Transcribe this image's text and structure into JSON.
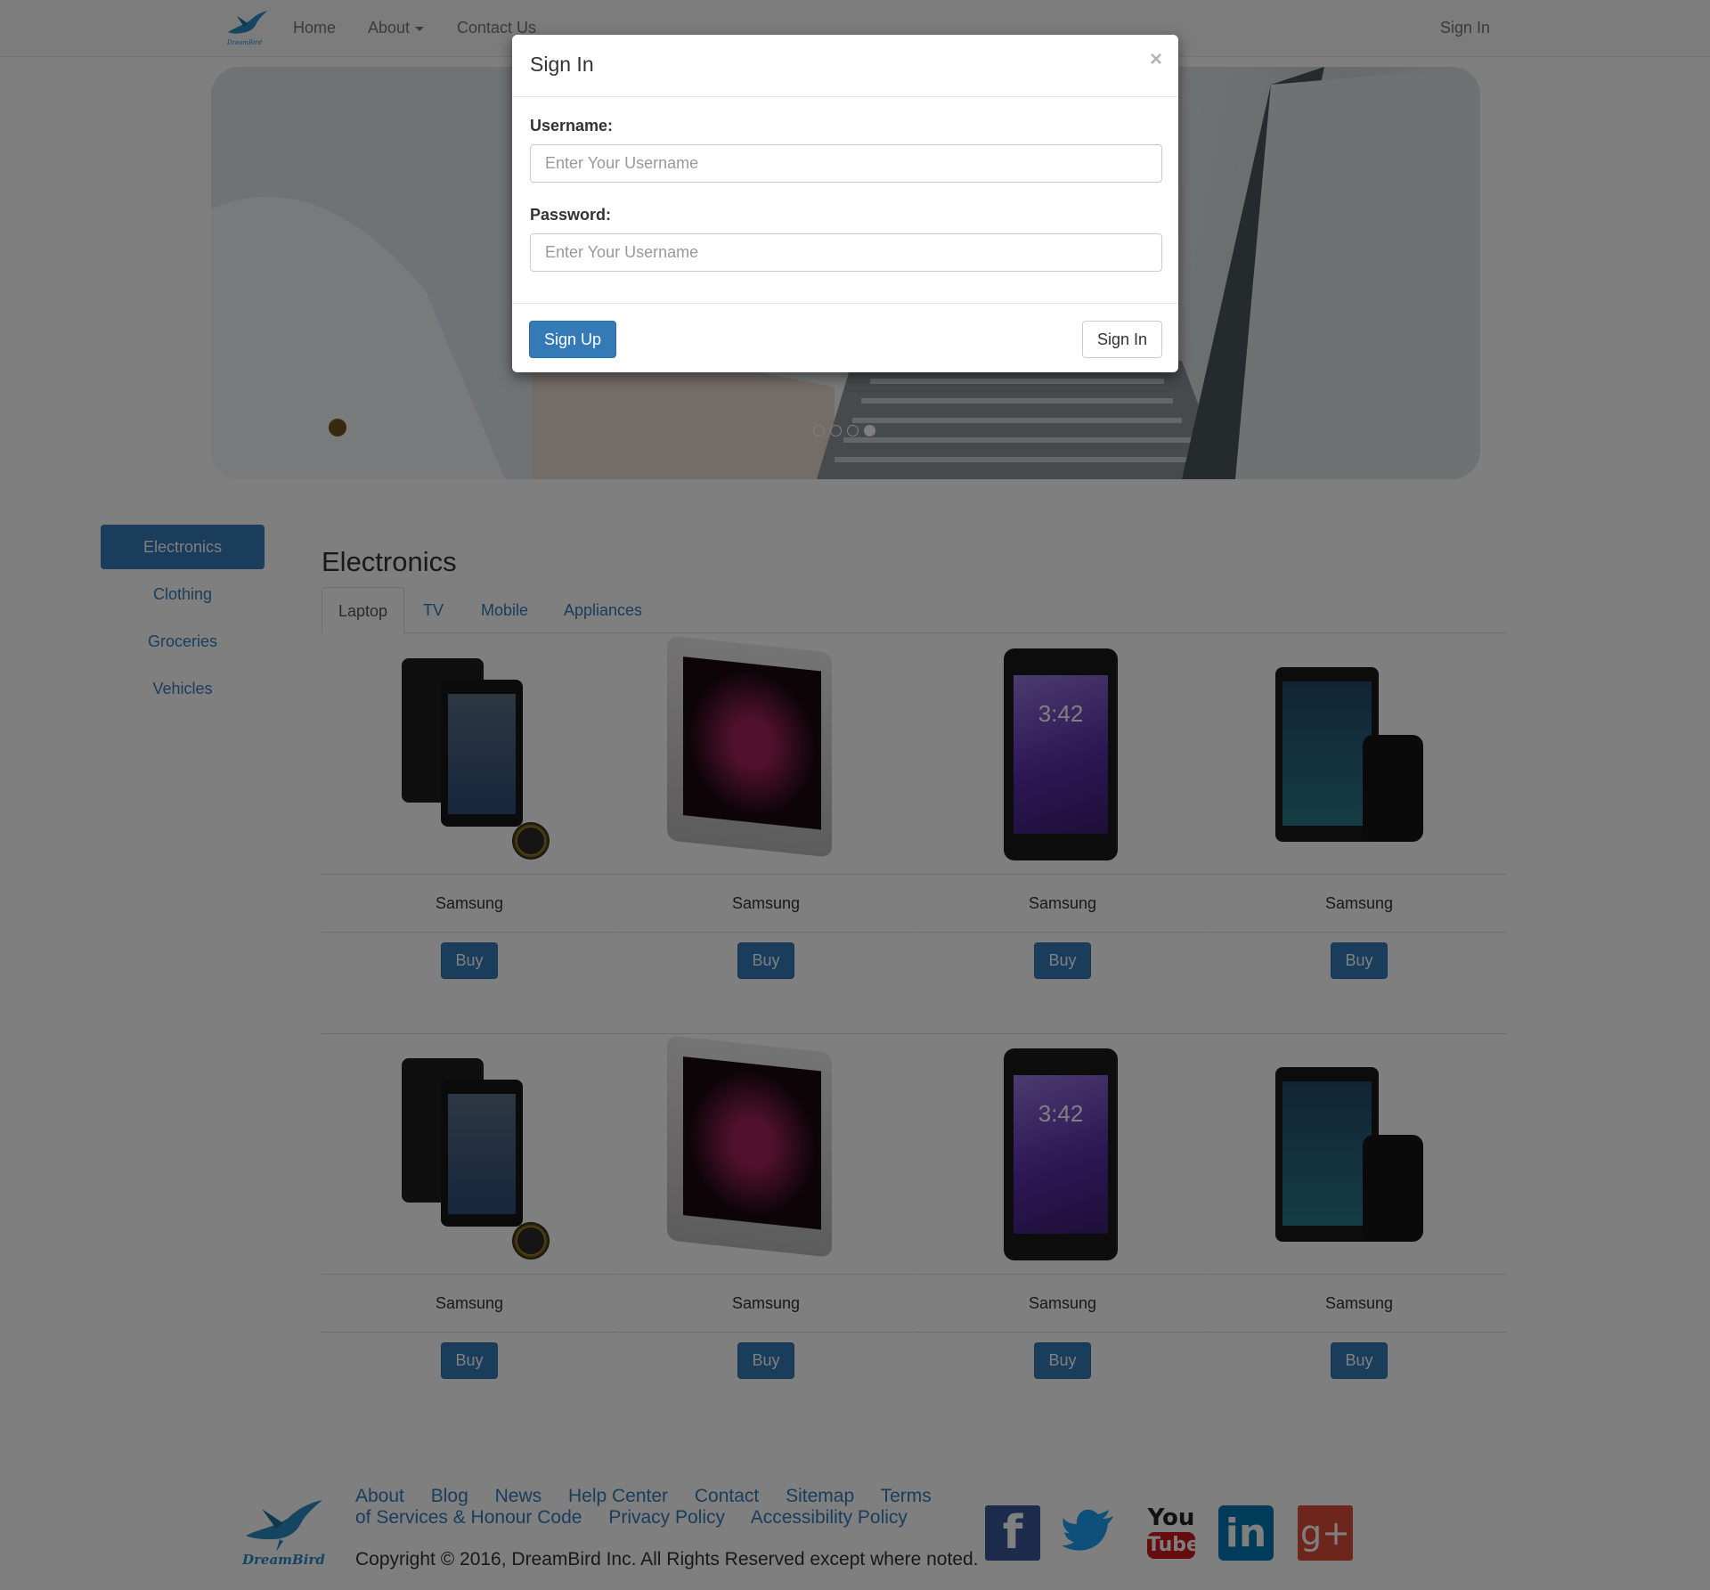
{
  "nav": {
    "home": "Home",
    "about": "About",
    "contact": "Contact Us",
    "signin": "Sign In"
  },
  "sidebar": {
    "items": [
      {
        "label": "Electronics",
        "active": true
      },
      {
        "label": "Clothing"
      },
      {
        "label": "Groceries"
      },
      {
        "label": "Vehicles"
      }
    ]
  },
  "main": {
    "title": "Electronics",
    "tabs": [
      {
        "label": "Laptop",
        "active": true
      },
      {
        "label": "TV"
      },
      {
        "label": "Mobile"
      },
      {
        "label": "Appliances"
      }
    ],
    "products_row1": [
      {
        "name": "Samsung",
        "buy": "Buy"
      },
      {
        "name": "Samsung",
        "buy": "Buy"
      },
      {
        "name": "Samsung",
        "buy": "Buy"
      },
      {
        "name": "Samsung",
        "buy": "Buy"
      }
    ],
    "products_row2": [
      {
        "name": "Samsung",
        "buy": "Buy"
      },
      {
        "name": "Samsung",
        "buy": "Buy"
      },
      {
        "name": "Samsung",
        "buy": "Buy"
      },
      {
        "name": "Samsung",
        "buy": "Buy"
      }
    ],
    "device_clock": "3:42"
  },
  "footer": {
    "links": [
      "About",
      "Blog",
      "News",
      "Help Center",
      "Contact",
      "Sitemap",
      "Terms of Services & Honour Code",
      "Privacy Policy",
      "Accessibility Policy"
    ],
    "copyright": "Copyright © 2016, DreamBird Inc. All Rights Reserved except where noted.",
    "social": {
      "facebook": "f",
      "linkedin": "in",
      "googleplus": "g+",
      "youtube_line1": "You",
      "youtube_line2": "Tube"
    },
    "logo_text": "DreamBird"
  },
  "modal": {
    "title": "Sign In",
    "close": "×",
    "username_label": "Username:",
    "username_placeholder": "Enter Your Username",
    "password_label": "Password:",
    "password_placeholder": "Enter Your Username",
    "signup_button": "Sign Up",
    "signin_button": "Sign In"
  },
  "colors": {
    "primary": "#337ab7",
    "navbar_bg": "#f8f8f8",
    "backdrop": "rgba(0,0,0,0.5)"
  },
  "icons": [
    "dreambird-logo-icon",
    "facebook-icon",
    "twitter-icon",
    "youtube-icon",
    "linkedin-icon",
    "googleplus-icon"
  ]
}
